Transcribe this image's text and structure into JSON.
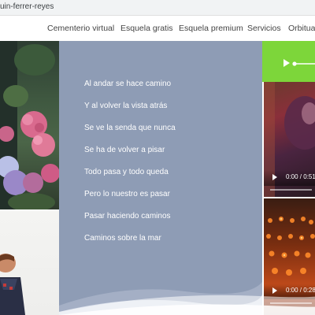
{
  "browser": {
    "url_fragment": "uin-ferrer-reyes"
  },
  "nav": {
    "items": [
      {
        "label": "Cementerio virtual"
      },
      {
        "label": "Esquela gratis"
      },
      {
        "label": "Esquela premium"
      },
      {
        "label": "Servicios"
      },
      {
        "label": "Orbituar"
      }
    ]
  },
  "poem": {
    "lines": [
      "Al andar se hace camino",
      "Y al volver la vista atrás",
      "Se ve la senda que nunca",
      "Se ha de volver a pisar",
      "Todo pasa y todo queda",
      "Pero lo nuestro es pasar",
      "Pasar haciendo caminos",
      "Caminos sobre la mar"
    ]
  },
  "media": {
    "audio": {
      "icon": "play-icon",
      "progress_fraction": 0.04
    },
    "video1": {
      "time": "0:00 / 0:51",
      "icon": "play-icon"
    },
    "video2": {
      "time": "0:00 / 0:28",
      "icon": "play-icon"
    }
  },
  "colors": {
    "poem_bg": "#8e9cb5",
    "audio_bg": "#7dd63a",
    "text_white": "#ffffff"
  }
}
